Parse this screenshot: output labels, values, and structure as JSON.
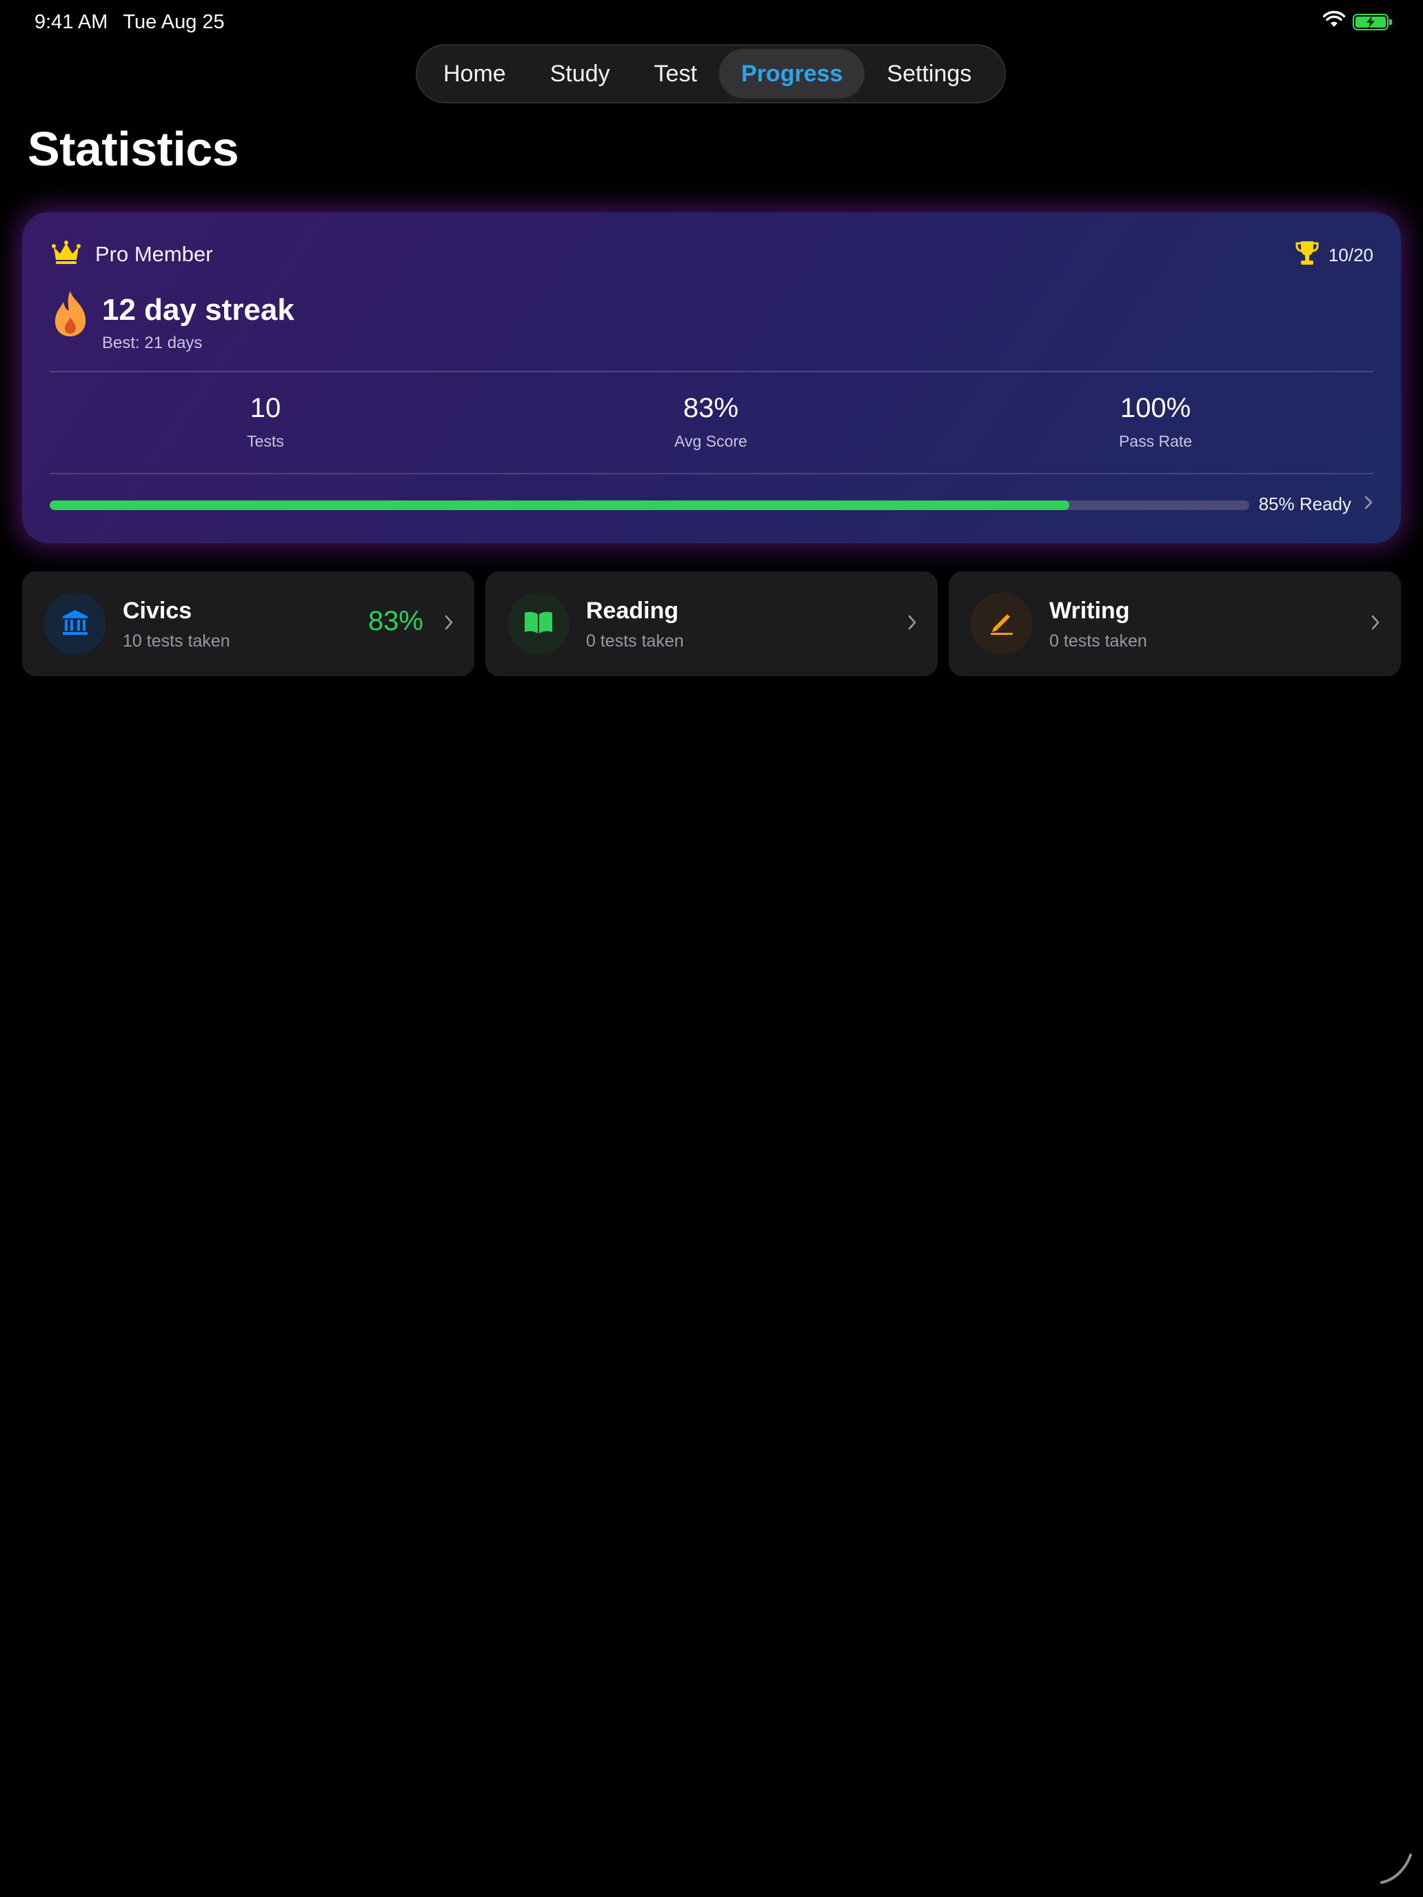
{
  "status_bar": {
    "time": "9:41 AM",
    "date": "Tue Aug 25",
    "icons": [
      "wifi-icon",
      "battery-charging-icon"
    ]
  },
  "tabs": [
    {
      "label": "Home",
      "active": false
    },
    {
      "label": "Study",
      "active": false
    },
    {
      "label": "Test",
      "active": false
    },
    {
      "label": "Progress",
      "active": true
    },
    {
      "label": "Settings",
      "active": false
    }
  ],
  "page_title": "Statistics",
  "stats_card": {
    "membership": "Pro Member",
    "trophy_count": "10/20",
    "streak_title": "12 day streak",
    "streak_best": "Best: 21 days",
    "metrics": [
      {
        "value": "10",
        "caption": "Tests"
      },
      {
        "value": "83%",
        "caption": "Avg Score"
      },
      {
        "value": "100%",
        "caption": "Pass Rate"
      }
    ],
    "readiness_fraction": 0.85,
    "readiness_label": "85% Ready"
  },
  "categories": [
    {
      "title": "Civics",
      "subtitle": "10 tests taken",
      "score": "83%",
      "icon": "bank-icon",
      "color": "#0a84ff"
    },
    {
      "title": "Reading",
      "subtitle": "0 tests taken",
      "score": "",
      "icon": "book-icon",
      "color": "#30d158"
    },
    {
      "title": "Writing",
      "subtitle": "0 tests taken",
      "score": "",
      "icon": "pencil-icon",
      "color": "#ff9f0a"
    }
  ],
  "colors": {
    "accent_blue": "#2ca5ec",
    "success_green": "#30d158",
    "gold": "#ffd60a",
    "flame_orange": "#ff9f40",
    "card_bg": "#1c1c1e"
  }
}
